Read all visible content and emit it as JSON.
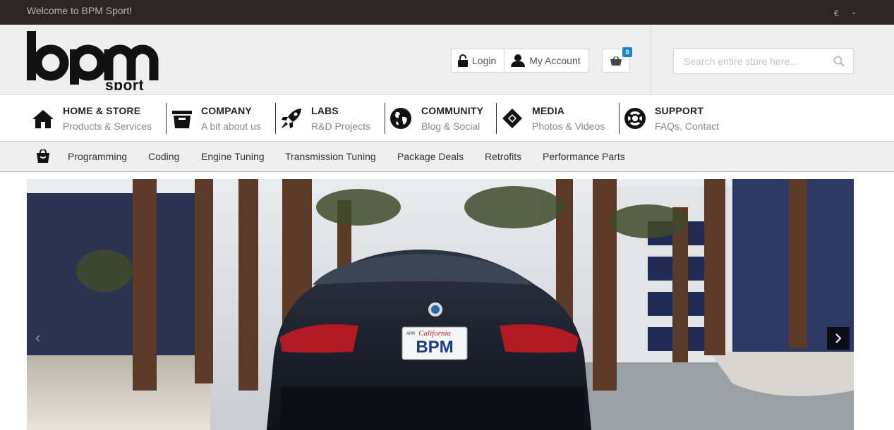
{
  "topbar": {
    "welcome": "Welcome to BPM Sport!",
    "currency": "€",
    "currency_chevron": "⌄"
  },
  "header": {
    "logo_text": "bpm",
    "logo_sub": "sport",
    "login_label": "Login",
    "account_label": "My Account",
    "cart_count": "0",
    "search_placeholder": "Search entire store here..."
  },
  "main_nav": [
    {
      "title": "HOME & STORE",
      "subtitle": "Products & Services",
      "icon": "home-icon"
    },
    {
      "title": "COMPANY",
      "subtitle": "A bit about us",
      "icon": "box-icon"
    },
    {
      "title": "LABS",
      "subtitle": "R&D Projects",
      "icon": "rocket-icon"
    },
    {
      "title": "COMMUNITY",
      "subtitle": "Blog & Social",
      "icon": "globe-icon"
    },
    {
      "title": "MEDIA",
      "subtitle": "Photos & Videos",
      "icon": "ticket-icon"
    },
    {
      "title": "SUPPORT",
      "subtitle": "FAQs, Contact",
      "icon": "lifebuoy-icon"
    }
  ],
  "sub_nav": {
    "icon": "shopping-bag-icon",
    "items": [
      "Programming",
      "Coding",
      "Engine Tuning",
      "Transmission Tuning",
      "Package Deals",
      "Retrofits",
      "Performance Parts"
    ]
  },
  "hero": {
    "plate_state": "California",
    "plate_text": "BPM",
    "plate_frame": "APR",
    "prev_icon": "chevron-left-icon",
    "next_icon": "chevron-right-icon"
  },
  "colors": {
    "topbar_bg": "#2b2624",
    "header_bg": "#efefef",
    "badge": "#1e84c6"
  }
}
